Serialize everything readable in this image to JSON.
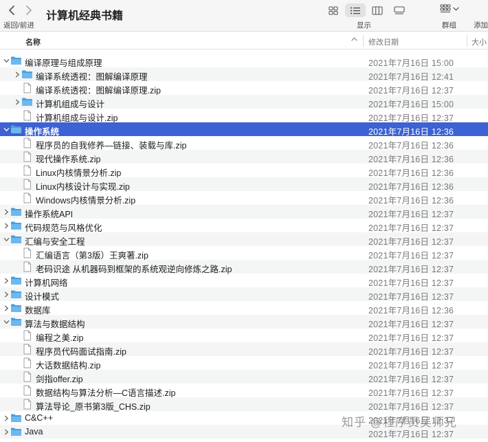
{
  "window": {
    "title": "计算机经典书籍",
    "nav_caption": "返回/前进",
    "view_caption": "显示",
    "group_caption": "群组",
    "add_caption": "添加"
  },
  "columns": {
    "name": "名称",
    "date": "修改日期",
    "size": "大小"
  },
  "rows": [
    {
      "level": 0,
      "type": "folder",
      "expanded": true,
      "name": "编译原理与组成原理",
      "date": "2021年7月16日 15:00"
    },
    {
      "level": 1,
      "type": "folder",
      "expanded": false,
      "name": "编译系统透视：图解编译原理",
      "date": "2021年7月16日 12:41"
    },
    {
      "level": 1,
      "type": "file",
      "name": "编译系统透视：图解编译原理.zip",
      "date": "2021年7月16日 12:37"
    },
    {
      "level": 1,
      "type": "folder",
      "expanded": false,
      "name": "计算机组成与设计",
      "date": "2021年7月16日 15:00"
    },
    {
      "level": 1,
      "type": "file",
      "name": "计算机组成与设计.zip",
      "date": "2021年7月16日 12:37"
    },
    {
      "level": 0,
      "type": "folder",
      "expanded": true,
      "selected": true,
      "name": "操作系统",
      "date": "2021年7月16日 12:36"
    },
    {
      "level": 1,
      "type": "file",
      "name": "程序员的自我修养—链接、装载与库.zip",
      "date": "2021年7月16日 12:36"
    },
    {
      "level": 1,
      "type": "file",
      "name": "现代操作系统.zip",
      "date": "2021年7月16日 12:36"
    },
    {
      "level": 1,
      "type": "file",
      "name": "Linux内核情景分析.zip",
      "date": "2021年7月16日 12:36"
    },
    {
      "level": 1,
      "type": "file",
      "name": "Linux内核设计与实现.zip",
      "date": "2021年7月16日 12:36"
    },
    {
      "level": 1,
      "type": "file",
      "name": "Windows内核情景分析.zip",
      "date": "2021年7月16日 12:36"
    },
    {
      "level": 0,
      "type": "folder",
      "expanded": false,
      "name": "操作系统API",
      "date": "2021年7月16日 12:37"
    },
    {
      "level": 0,
      "type": "folder",
      "expanded": false,
      "name": "代码规范与风格优化",
      "date": "2021年7月16日 12:37"
    },
    {
      "level": 0,
      "type": "folder",
      "expanded": true,
      "name": "汇编与安全工程",
      "date": "2021年7月16日 12:37"
    },
    {
      "level": 1,
      "type": "file",
      "name": "汇编语言（第3版）王爽著.zip",
      "date": "2021年7月16日 12:37"
    },
    {
      "level": 1,
      "type": "file",
      "name": "老码识途 从机器码到框架的系统观逆向修炼之路.zip",
      "date": "2021年7月16日 12:37"
    },
    {
      "level": 0,
      "type": "folder",
      "expanded": false,
      "name": "计算机网络",
      "date": "2021年7月16日 12:37"
    },
    {
      "level": 0,
      "type": "folder",
      "expanded": false,
      "name": "设计模式",
      "date": "2021年7月16日 12:37"
    },
    {
      "level": 0,
      "type": "folder",
      "expanded": false,
      "name": "数据库",
      "date": "2021年7月16日 12:36"
    },
    {
      "level": 0,
      "type": "folder",
      "expanded": true,
      "name": "算法与数据结构",
      "date": "2021年7月16日 12:37"
    },
    {
      "level": 1,
      "type": "file",
      "name": "编程之美.zip",
      "date": "2021年7月16日 12:37"
    },
    {
      "level": 1,
      "type": "file",
      "name": "程序员代码面试指南.zip",
      "date": "2021年7月16日 12:37"
    },
    {
      "level": 1,
      "type": "file",
      "name": "大话数据结构.zip",
      "date": "2021年7月16日 12:37"
    },
    {
      "level": 1,
      "type": "file",
      "name": "剑指offer.zip",
      "date": "2021年7月16日 12:37"
    },
    {
      "level": 1,
      "type": "file",
      "name": "数据结构与算法分析—C语言描述.zip",
      "date": "2021年7月16日 12:37"
    },
    {
      "level": 1,
      "type": "file",
      "name": "算法导论_原书第3版_CHS.zip",
      "date": "2021年7月16日 12:37"
    },
    {
      "level": 0,
      "type": "folder",
      "expanded": false,
      "name": "C&C++",
      "date": "2021年7月16日 12:37"
    },
    {
      "level": 0,
      "type": "folder",
      "expanded": false,
      "name": "Java",
      "date": "2021年7月16日 12:37"
    }
  ],
  "watermark": "知乎 @程序员吴师兄",
  "colors": {
    "selection": "#3c62d3",
    "folder": "#5aa9e6",
    "stripe": "#f4f5f5"
  }
}
